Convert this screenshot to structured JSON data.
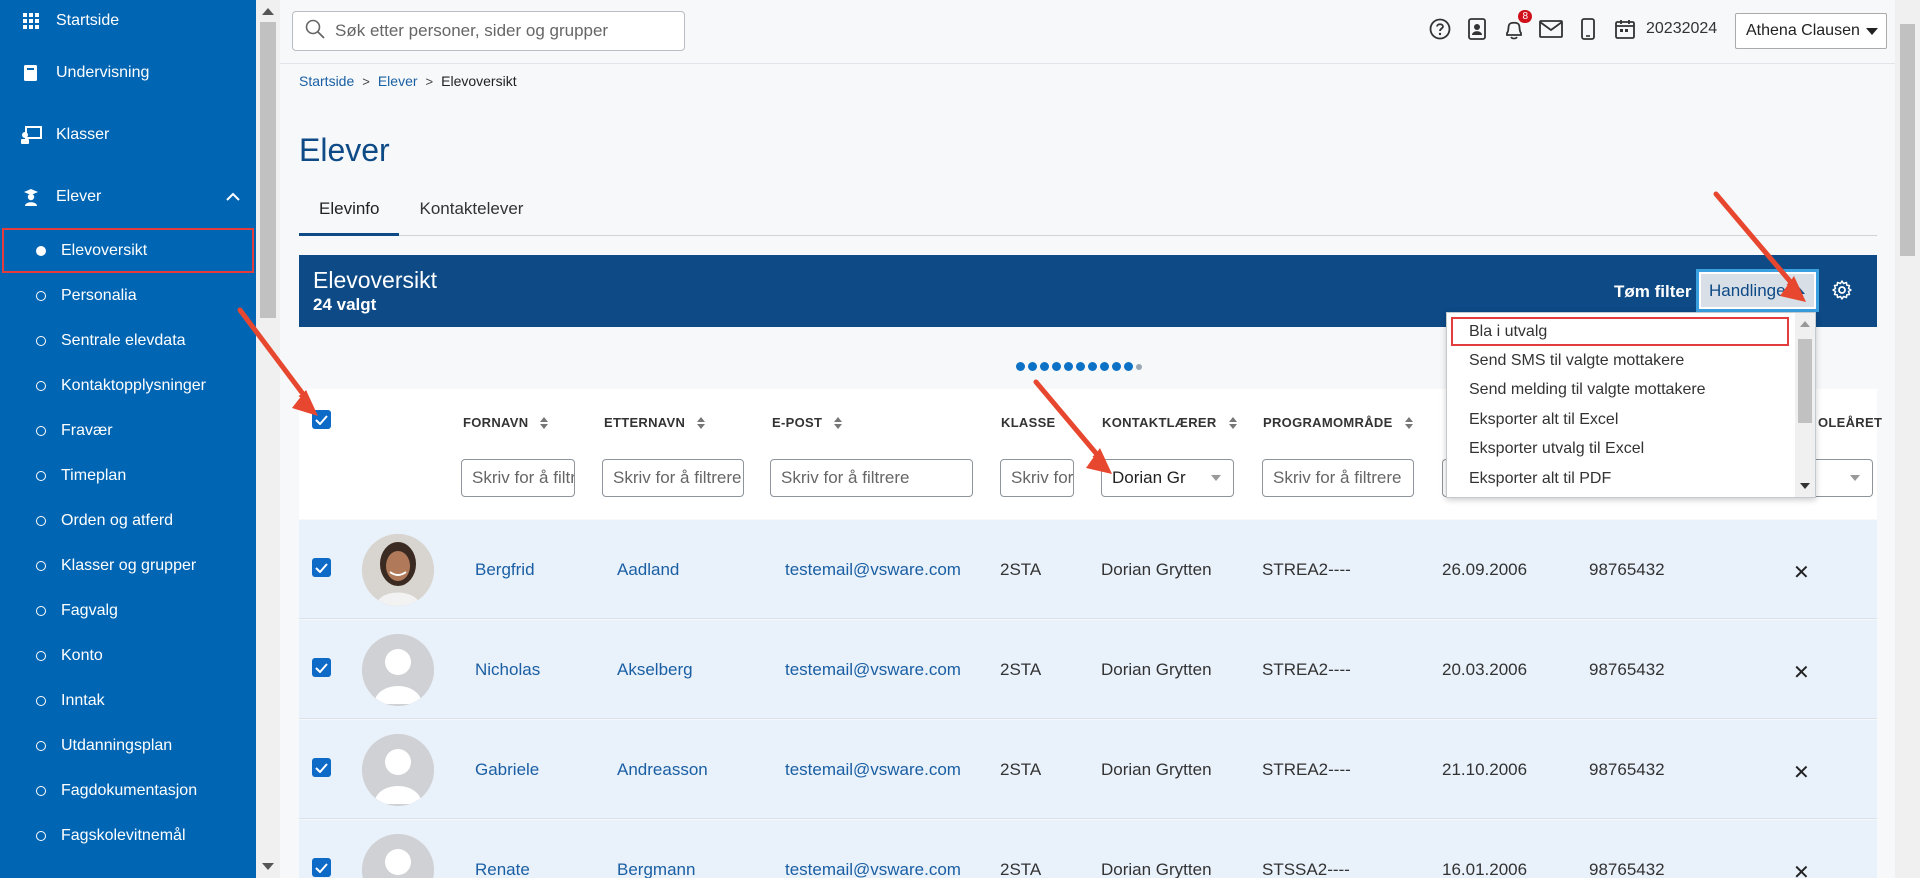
{
  "sidebar": {
    "main_items": [
      {
        "label": "Startside",
        "icon": "grid-icon"
      },
      {
        "label": "Undervisning",
        "icon": "book-icon"
      },
      {
        "label": "Klasser",
        "icon": "classroom-icon"
      },
      {
        "label": "Elever",
        "icon": "student-icon"
      }
    ],
    "sub_items": [
      "Elevoversikt",
      "Personalia",
      "Sentrale elevdata",
      "Kontaktopplysninger",
      "Fravær",
      "Timeplan",
      "Orden og atferd",
      "Klasser og grupper",
      "Fagvalg",
      "Konto",
      "Inntak",
      "Utdanningsplan",
      "Fagdokumentasjon",
      "Fagskolevitnemål"
    ]
  },
  "topbar": {
    "search_placeholder": "Søk etter personer, sider og grupper",
    "notification_count": "8",
    "school_year": "20232024",
    "user_name": "Athena Clausen"
  },
  "breadcrumb": {
    "home": "Startside",
    "parent": "Elever",
    "current": "Elevoversikt"
  },
  "page": {
    "title": "Elever",
    "tabs": [
      "Elevinfo",
      "Kontaktelever"
    ]
  },
  "panel": {
    "title": "Elevoversikt",
    "selected_count": "24 valgt",
    "clear_filter": "Tøm filter",
    "actions": "Handlinger"
  },
  "actions_menu": [
    "Bla i utvalg",
    "Send SMS til valgte mottakere",
    "Send melding til valgte mottakere",
    "Eksporter alt til Excel",
    "Eksporter utvalg til Excel",
    "Eksporter alt til PDF"
  ],
  "table": {
    "headers": {
      "fornavn": "FORNAVN",
      "etternavn": "ETTERNAVN",
      "epost": "E-POST",
      "klasse": "KLASSE",
      "kontaktlaerer": "KONTAKTLÆRER",
      "programomrade": "PROGRAMOMRÅDE",
      "skolearet": "OLEÅRET"
    },
    "filters": {
      "fornavn": "Skriv for å filtrere",
      "etternavn": "Skriv for å filtrere",
      "epost": "Skriv for å filtrere",
      "klasse": "Skriv for å filtrere",
      "kontaktlaerer_value": "Dorian Gr",
      "programomrade": "Skriv for å filtrere"
    },
    "rows": [
      {
        "fornavn": "Bergfrid",
        "etternavn": "Aadland",
        "epost": "testemail@vsware.com",
        "klasse": "2STA",
        "kontaktlaerer": "Dorian Grytten",
        "programomrade": "STREA2----",
        "fodselsdato": "26.09.2006",
        "telefon": "98765432",
        "photo": true
      },
      {
        "fornavn": "Nicholas",
        "etternavn": "Akselberg",
        "epost": "testemail@vsware.com",
        "klasse": "2STA",
        "kontaktlaerer": "Dorian Grytten",
        "programomrade": "STREA2----",
        "fodselsdato": "20.03.2006",
        "telefon": "98765432",
        "photo": false
      },
      {
        "fornavn": "Gabriele",
        "etternavn": "Andreasson",
        "epost": "testemail@vsware.com",
        "klasse": "2STA",
        "kontaktlaerer": "Dorian Grytten",
        "programomrade": "STREA2----",
        "fodselsdato": "21.10.2006",
        "telefon": "98765432",
        "photo": false
      },
      {
        "fornavn": "Renate",
        "etternavn": "Bergmann",
        "epost": "testemail@vsware.com",
        "klasse": "2STA",
        "kontaktlaerer": "Dorian Grytten",
        "programomrade": "STSSA2----",
        "fodselsdato": "16.01.2006",
        "telefon": "98765432",
        "photo": false
      }
    ]
  },
  "colors": {
    "sidebar": "#0065b3",
    "header_blue": "#0d4a86",
    "link": "#1a5fa3",
    "highlight_red": "#e23d3d",
    "row_bg": "#e9f1fb"
  }
}
